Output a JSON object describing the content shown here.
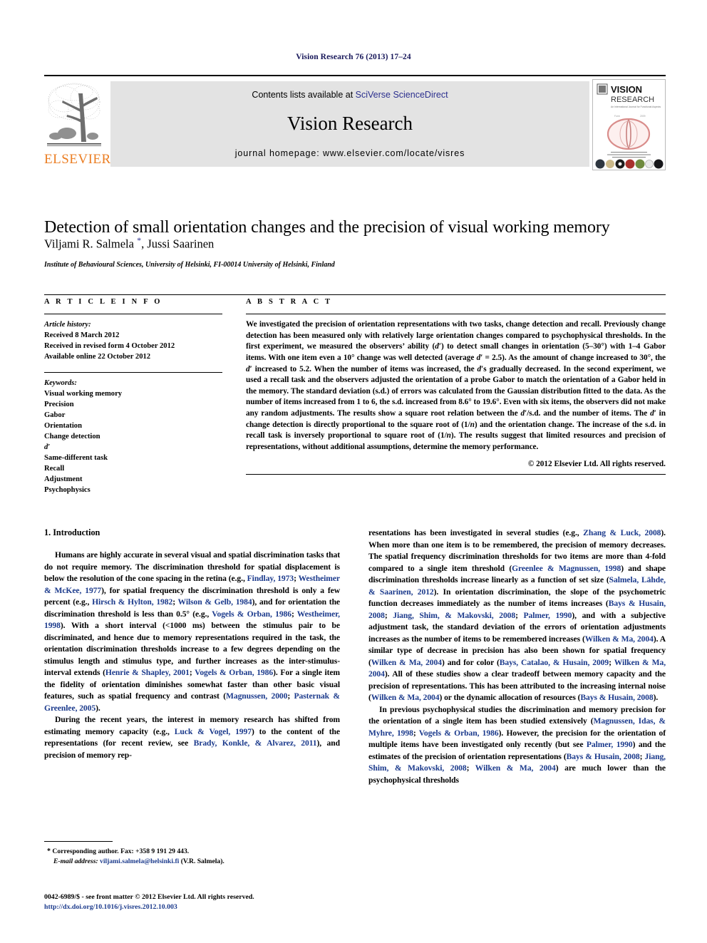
{
  "running_head": "Vision Research 76 (2013) 17–24",
  "masthead": {
    "contents_prefix": "Contents lists available at ",
    "contents_link": "SciVerse ScienceDirect",
    "journal_name": "Vision Research",
    "homepage_label": "journal homepage: www.elsevier.com/locate/visres",
    "publisher": "ELSEVIER",
    "cover": {
      "title_line1": "VISION",
      "title_line2": "RESEARCH",
      "subtitle": "An International Journal for Functional Aspects of Vision"
    }
  },
  "article": {
    "title": "Detection of small orientation changes and the precision of visual working memory",
    "authors": "Viljami R. Salmela ",
    "corresponding_marker": "*",
    "authors_rest": ", Jussi Saarinen",
    "affiliation": "Institute of Behavioural Sciences, University of Helsinki, FI-00014 University of Helsinki, Finland"
  },
  "info": {
    "heading": "A R T I C L E   I N F O",
    "history_label": "Article history:",
    "history": [
      "Received 8 March 2012",
      "Received in revised form 4 October 2012",
      "Available online 22 October 2012"
    ],
    "keywords_label": "Keywords:",
    "keywords": [
      "Visual working memory",
      "Precision",
      "Gabor",
      "Orientation",
      "Change detection",
      "d′",
      "Same-different task",
      "Recall",
      "Adjustment",
      "Psychophysics"
    ]
  },
  "abstract": {
    "heading": "A B S T R A C T",
    "paragraphs": [
      "We investigated the precision of orientation representations with two tasks, change detection and recall. Previously change detection has been measured only with relatively large orientation changes compared to psychophysical thresholds. In the first experiment, we measured the observers’ ability (d′) to detect small changes in orientation (5–30°) with 1–4 Gabor items. With one item even a 10° change was well detected (average d′ = 2.5). As the amount of change increased to 30°, the d′ increased to 5.2. When the number of items was increased, the d′s gradually decreased. In the second experiment, we used a recall task and the observers adjusted the orientation of a probe Gabor to match the orientation of a Gabor held in the memory. The standard deviation (s.d.) of errors was calculated from the Gaussian distribution fitted to the data. As the number of items increased from 1 to 6, the s.d. increased from 8.6° to 19.6°. Even with six items, the observers did not make any random adjustments. The results show a square root relation between the d′/s.d. and the number of items. The d′ in change detection is directly proportional to the square root of (1/n) and the orientation change. The increase of the s.d. in recall task is inversely proportional to square root of (1/n). The results suggest that limited resources and precision of representations, without additional assumptions, determine the memory performance."
    ],
    "copyright": "© 2012 Elsevier Ltd. All rights reserved."
  },
  "body": {
    "section_heading": "1. Introduction",
    "left_paragraphs": [
      "Humans are highly accurate in several visual and spatial discrimination tasks that do not require memory. The discrimination threshold for spatial displacement is below the resolution of the cone spacing in the retina (e.g., Findlay, 1973; Westheimer & McKee, 1977), for spatial frequency the discrimination threshold is only a few percent (e.g., Hirsch & Hylton, 1982; Wilson & Gelb, 1984), and for orientation the discrimination threshold is less than 0.5° (e.g., Vogels & Orban, 1986; Westheimer, 1998). With a short interval (<1000 ms) between the stimulus pair to be discriminated, and hence due to memory representations required in the task, the orientation discrimination thresholds increase to a few degrees depending on the stimulus length and stimulus type, and further increases as the inter-stimulus-interval extends (Henrie & Shapley, 2001; Vogels & Orban, 1986). For a single item the fidelity of orientation diminishes somewhat faster than other basic visual features, such as spatial frequency and contrast (Magnussen, 2000; Pasternak & Greenlee, 2005).",
      "During the recent years, the interest in memory research has shifted from estimating memory capacity (e.g., Luck & Vogel, 1997) to the content of the representations (for recent review, see Brady, Konkle, & Alvarez, 2011), and precision of memory rep-"
    ],
    "right_paragraphs": [
      "resentations has been investigated in several studies (e.g., Zhang & Luck, 2008). When more than one item is to be remembered, the precision of memory decreases. The spatial frequency discrimination thresholds for two items are more than 4-fold compared to a single item threshold (Greenlee & Magnussen, 1998) and shape discrimination thresholds increase linearly as a function of set size (Salmela, Lähde, & Saarinen, 2012). In orientation discrimination, the slope of the psychometric function decreases immediately as the number of items increases (Bays & Husain, 2008; Jiang, Shim, & Makovski, 2008; Palmer, 1990), and with a subjective adjustment task, the standard deviation of the errors of orientation adjustments increases as the number of items to be remembered increases (Wilken & Ma, 2004). A similar type of decrease in precision has also been shown for spatial frequency (Wilken & Ma, 2004) and for color (Bays, Catalao, & Husain, 2009; Wilken & Ma, 2004). All of these studies show a clear tradeoff between memory capacity and the precision of representations. This has been attributed to the increasing internal noise (Wilken & Ma, 2004) or the dynamic allocation of resources (Bays & Husain, 2008).",
      "In previous psychophysical studies the discrimination and memory precision for the orientation of a single item has been studied extensively (Magnussen, Idas, & Myhre, 1998; Vogels & Orban, 1986). However, the precision for the orientation of multiple items have been investigated only recently (but see Palmer, 1990) and the estimates of the precision of orientation representations (Bays & Husain, 2008; Jiang, Shim, & Makovski, 2008; Wilken & Ma, 2004) are much lower than the psychophysical thresholds"
    ]
  },
  "footnote": {
    "corresponding": "Corresponding author. Fax: +358 9 191 29 443.",
    "email_label": "E-mail address:",
    "email": "viljami.salmela@helsinki.fi",
    "email_suffix": " (V.R. Salmela)."
  },
  "bottom": {
    "issn_line": "0042-6989/$ - see front matter © 2012 Elsevier Ltd. All rights reserved.",
    "doi": "http://dx.doi.org/10.1016/j.visres.2012.10.003"
  },
  "colors": {
    "link": "#2b2f8e",
    "citation": "#1b3a8c",
    "elsevier_orange": "#eb7e23",
    "band_grey": "#e3e3e3",
    "running_head": "#17175a"
  }
}
